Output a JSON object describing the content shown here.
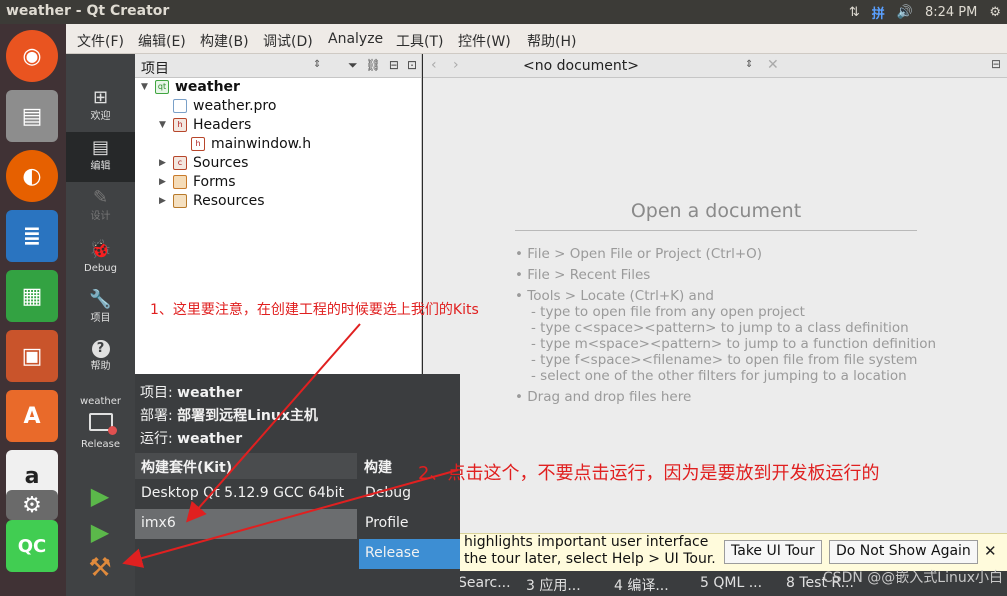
{
  "window": {
    "title": "weather - Qt Creator"
  },
  "tray": {
    "ime": "拼",
    "volume": "🔊",
    "network": "⇅",
    "time": "8:24 PM",
    "power": "⚙"
  },
  "launcher": [
    {
      "name": "ubuntu-icon",
      "glyph": "◉"
    },
    {
      "name": "files-icon",
      "glyph": "▤"
    },
    {
      "name": "firefox-icon",
      "glyph": "◐"
    },
    {
      "name": "writer-icon",
      "glyph": "≣"
    },
    {
      "name": "calc-icon",
      "glyph": "▦"
    },
    {
      "name": "impress-icon",
      "glyph": "▣"
    },
    {
      "name": "software-icon",
      "glyph": "A"
    },
    {
      "name": "amazon-icon",
      "glyph": "a"
    },
    {
      "name": "settings-icon",
      "glyph": "⚙"
    },
    {
      "name": "qtcreator-icon",
      "glyph": "QC"
    }
  ],
  "menu": [
    "文件(F)",
    "编辑(E)",
    "构建(B)",
    "调试(D)",
    "Analyze",
    "工具(T)",
    "控件(W)",
    "帮助(H)"
  ],
  "modes": [
    {
      "label": "欢迎",
      "icon": "⊞"
    },
    {
      "label": "编辑",
      "icon": "▤"
    },
    {
      "label": "设计",
      "icon": "✎"
    },
    {
      "label": "Debug",
      "icon": "🐞"
    },
    {
      "label": "项目",
      "icon": "🔧"
    },
    {
      "label": "帮助",
      "icon": "?"
    }
  ],
  "run_selector": {
    "project": "weather",
    "label": "Release"
  },
  "project_pane": {
    "title": "项目"
  },
  "tree": [
    {
      "label": "weather",
      "bold": true
    },
    {
      "label": "weather.pro"
    },
    {
      "label": "Headers"
    },
    {
      "label": "mainwindow.h"
    },
    {
      "label": "Sources"
    },
    {
      "label": "Forms"
    },
    {
      "label": "Resources"
    }
  ],
  "editor": {
    "doc_selector": "<no document>",
    "open_heading": "Open a document",
    "hints": [
      "• File > Open File or Project (Ctrl+O)",
      "• File > Recent Files",
      "• Tools > Locate (Ctrl+K) and",
      "- type to open file from any open project",
      "- type c<space><pattern> to jump to a class definition",
      "- type m<space><pattern> to jump to a function definition",
      "- type f<space><filename> to open file from file system",
      "- select one of the other filters for jumping to a location",
      "• Drag and drop files here"
    ]
  },
  "tour": {
    "line1": "highlights important user interface",
    "line2": "the tour later, select Help > UI Tour.",
    "take": "Take UI Tour",
    "dismiss": "Do Not Show Again",
    "close": "✕"
  },
  "outputs": [
    "Searc...",
    "3  应用...",
    "4  编译...",
    "5  QML ...",
    "8  Test R..."
  ],
  "popup": {
    "project_key": "项目:",
    "project_val": "weather",
    "deploy_key": "部署:",
    "deploy_val": "部署到远程Linux主机",
    "run_key": "运行:",
    "run_val": "weather",
    "kit_header": "构建套件(Kit)",
    "build_header": "构建",
    "kits": [
      "Desktop Qt 5.12.9 GCC 64bit",
      "imx6"
    ],
    "builds": [
      "Debug",
      "Profile",
      "Release"
    ]
  },
  "annotations": {
    "a1": "1、这里要注意，在创建工程的时候要选上我们的Kits",
    "a2": "2、点击这个，不要点击运行，因为是要放到开发板运行的"
  },
  "watermark": "CSDN @@嵌入式Linux小白",
  "colors": {
    "accent": "#3d8ed3",
    "annotation": "#e02020",
    "launcher_bg": "#403235",
    "qt_green": "#41cd52"
  }
}
